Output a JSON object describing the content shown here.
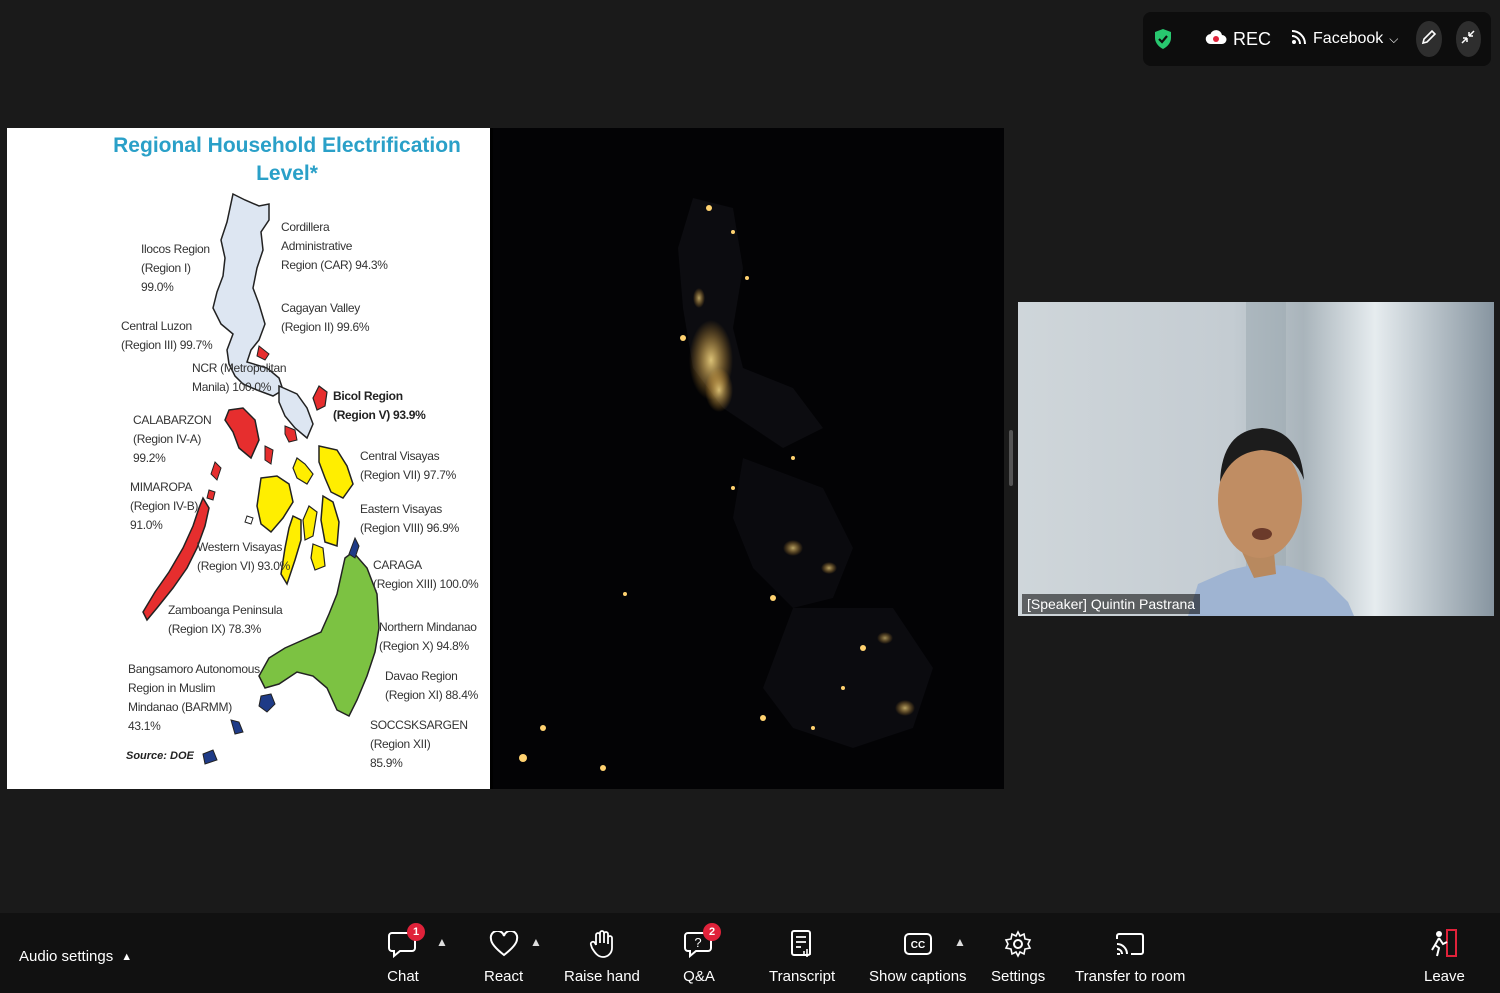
{
  "topbar": {
    "rec_label": "REC",
    "live_label": "Facebook",
    "icons": [
      "shield-check-icon",
      "cloud-record-icon",
      "broadcast-icon",
      "chevron-down-icon",
      "pen-annotate-icon",
      "collapse-icon"
    ]
  },
  "slide": {
    "title_line1": "Regional Household Electrification",
    "title_line2": "Level*",
    "source": "Source:  DOE",
    "regions": [
      {
        "text": "Cordillera\nAdministrative\nRegion (CAR) 94.3%"
      },
      {
        "text": "Ilocos Region\n(Region I)\n99.0%"
      },
      {
        "text": "Cagayan Valley\n(Region II) 99.6%"
      },
      {
        "text": "Central Luzon\n(Region III) 99.7%"
      },
      {
        "text": "NCR (Metropolitan\nManila) 100.0%"
      },
      {
        "text": "Bicol Region\n(Region V) 93.9%"
      },
      {
        "text": "CALABARZON\n(Region IV-A)\n99.2%"
      },
      {
        "text": "Central Visayas\n(Region VII) 97.7%"
      },
      {
        "text": "MIMAROPA\n(Region IV-B)\n91.0%"
      },
      {
        "text": "Eastern Visayas\n(Region VIII) 96.9%"
      },
      {
        "text": "Western Visayas\n(Region VI) 93.0%"
      },
      {
        "text": "CARAGA\n(Region XIII) 100.0%"
      },
      {
        "text": "Zamboanga Peninsula\n(Region IX) 78.3%"
      },
      {
        "text": "Northern Mindanao\n(Region X) 94.8%"
      },
      {
        "text": "Bangsamoro Autonomous\nRegion in Muslim\nMindanao (BARMM)\n43.1%"
      },
      {
        "text": "Davao Region\n(Region XI) 88.4%"
      },
      {
        "text": "SOCCSKSARGEN\n(Region XII)\n85.9%"
      }
    ]
  },
  "video": {
    "name_label": "[Speaker] Quintin Pastrana"
  },
  "toolbar": {
    "audio_label": "Audio settings",
    "chat_label": "Chat",
    "chat_badge": "1",
    "react_label": "React",
    "raise_label": "Raise hand",
    "qa_label": "Q&A",
    "qa_badge": "2",
    "transcript_label": "Transcript",
    "captions_label": "Show captions",
    "settings_label": "Settings",
    "transfer_label": "Transfer to room",
    "leave_label": "Leave"
  },
  "colors": {
    "region_red": "#e62e2e",
    "region_yellow": "#ffee00",
    "region_green": "#7cc242",
    "region_navy": "#1f3b87",
    "region_light": "#dde6f2",
    "title_blue": "#2aa0c8",
    "shield_green": "#28c76f",
    "badge_red": "#e0223a"
  }
}
